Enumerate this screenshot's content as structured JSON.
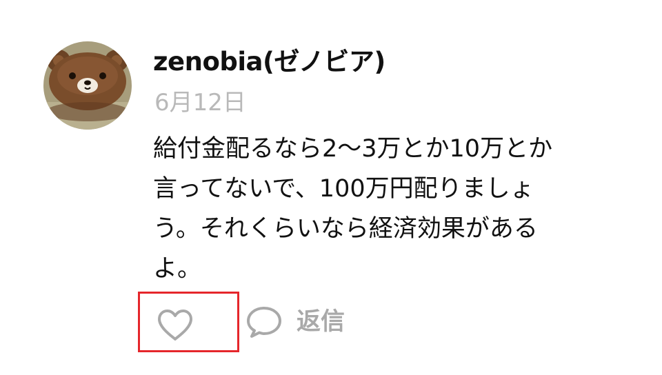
{
  "comment": {
    "avatar_icon": "teddy-bear-avatar",
    "username": "zenobia(ゼノビア)",
    "date": "6月12日",
    "text_lines": [
      "給付金配るなら2〜3万とか10万とか",
      "言ってないで、100万円配りましょ",
      "う。それくらいなら経済効果がある",
      "よ。"
    ]
  },
  "actions": {
    "like_icon": "heart-outline-icon",
    "reply_icon": "speech-bubble-icon",
    "reply_label": "返信",
    "highlight_color": "#e5262b",
    "muted_color": "#a9a9a9"
  }
}
